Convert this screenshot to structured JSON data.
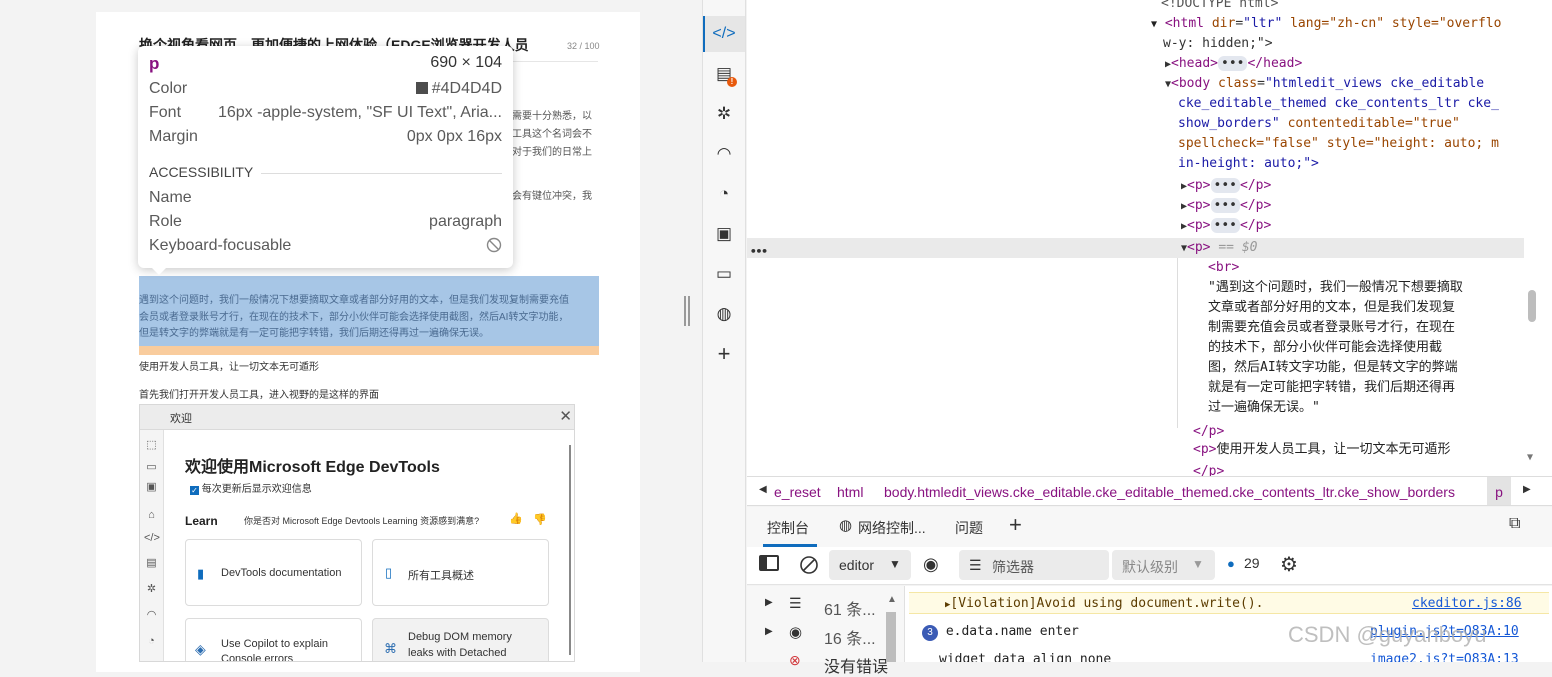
{
  "article": {
    "title": "换个视角看网页，更加便捷的上网体验（EDGE浏览器开发人员",
    "counter": "32 / 100",
    "partial_lines": [
      "需要十分熟悉，以",
      "工具这个名词会不",
      "对于我们的日常上",
      "会有键位冲突，我"
    ],
    "highlight_lines": [
      "遇到这个问题时，我们一般情况下想要摘取文章或者部分好用的文本，但是我们发现复制需要充值",
      "会员或者登录账号才行，在现在的技术下，部分小伙伴可能会选择使用截图，然后AI转文字功能，",
      "但是转文字的弊端就是有一定可能把字转错，我们后期还得再过一遍确保无误。"
    ],
    "para1": "使用开发人员工具，让一切文本无可遁形",
    "para2": "首先我们打开开发人员工具，进入视野的是这样的界面"
  },
  "tooltip": {
    "tag": "p",
    "size": "690 × 104",
    "color_label": "Color",
    "color_value": "#4D4D4D",
    "font_label": "Font",
    "font_value": "16px -apple-system, \"SF UI Text\", Aria...",
    "margin_label": "Margin",
    "margin_value": "0px 0px 16px",
    "accessibility_header": "ACCESSIBILITY",
    "name_label": "Name",
    "role_label": "Role",
    "role_value": "paragraph",
    "keyboard_label": "Keyboard-focusable"
  },
  "welcome": {
    "tab": "欢迎",
    "heading": "欢迎使用Microsoft Edge DevTools",
    "checkbox_label": "每次更新后显示欢迎信息",
    "learn": "Learn",
    "feedback_q": "你是否对 Microsoft Edge Devtools Learning 资源感到满意?",
    "cards": [
      "DevTools documentation",
      "所有工具概述",
      "Use Copilot to explain Console errors",
      "Debug DOM memory leaks with Detached"
    ]
  },
  "elements": {
    "doctype": "<!DOCTYPE html>",
    "html_line1": "lang=\"zh-cn\" style=\"overflo",
    "html_line2": "w-y: hidden;\">",
    "body_class1": "\"htmledit_views cke_editable",
    "body_class2": "cke_editable_themed cke_contents_ltr cke_",
    "body_class3": "show_borders\"",
    "body_ce": "contenteditable=\"true\"",
    "body_sc": "spellcheck=\"false\"",
    "body_style1": "style=\"height: auto; m",
    "body_style2": "in-height: auto;\">",
    "selected_marker": "== $0",
    "text_lines": [
      "\"遇到这个问题时，我们一般情况下想要摘取",
      "文章或者部分好用的文本，但是我们发现复",
      "制需要充值会员或者登录账号才行，在现在",
      "的技术下，部分小伙伴可能会选择使用截",
      "图，然后AI转文字功能，但是转文字的弊端",
      "就是有一定可能把字转错，我们后期还得再",
      "过一遍确保无误。\""
    ],
    "next_p_text": "使用开发人员工具，让一切文本无可遁形"
  },
  "breadcrumbs": [
    "e_reset",
    "html",
    "body.htmledit_views.cke_editable.cke_editable_themed.cke_contents_ltr.cke_show_borders",
    "p"
  ],
  "drawer_tabs": {
    "console": "控制台",
    "network": "网络控制...",
    "issues": "问题"
  },
  "console_toolbar": {
    "context": "editor",
    "filter": "筛选器",
    "level": "默认级别",
    "issue_count": "29"
  },
  "console_sidebar": [
    {
      "count": "61 条..."
    },
    {
      "count": "16 条..."
    },
    {
      "count": "没有错误"
    }
  ],
  "console_messages": [
    {
      "text": "[Violation]Avoid using document.write().",
      "link": "ckeditor.js:86"
    },
    {
      "badge": "3",
      "text": "e.data.name enter",
      "link": "plugin.js?t=O83A:10"
    },
    {
      "text": "widget data align none",
      "link": "image2.js?t=O83A:13"
    }
  ],
  "watermark": "CSDN @guyanboyu",
  "colors": {
    "highlight_content": "#a7c6e6",
    "highlight_margin": "#f9cc9d",
    "color_swatch": "#4D4D4D",
    "accent": "#0f6cbd"
  }
}
